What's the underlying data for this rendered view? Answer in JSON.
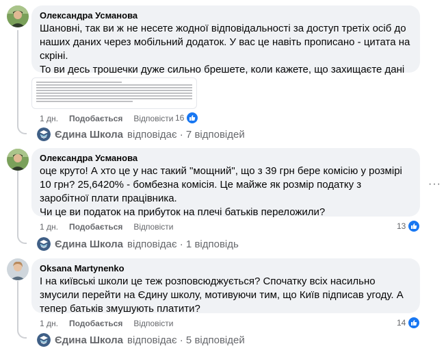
{
  "comments": [
    {
      "author": "Олександра Усманова",
      "paragraphs": [
        "Шановні, так ви ж не несете жодної відповідальності за доступ третіх осіб до наших даних через мобільний додаток. У вас це навіть прописано - цитата на скріні.",
        "То ви десь трошечки дуже сильно брешете, коли кажете, що захищаєте дані користувачів."
      ],
      "time": "1 дн.",
      "like_label": "Подобається",
      "reply_label": "Відповісти",
      "reactions": "16",
      "replies_page": "Єдина Школа",
      "replies_text": "відповідає · 7 відповідей"
    },
    {
      "author": "Олександра Усманова",
      "paragraphs": [
        "оце круто! А хто це у нас такий \"мощний\", що з 39 грн бере комісію у розмірі 10 грн? 25,6420% - бомбезна комісія. Це майже як розмір податку з заробітної плати працівника.",
        "Чи це ви податок на прибуток на плечі батьків переложили?"
      ],
      "time": "1 дн.",
      "like_label": "Подобається",
      "reply_label": "Відповісти",
      "reactions": "13",
      "replies_page": "Єдина Школа",
      "replies_text": "відповідає · 1 відповідь"
    },
    {
      "author": "Oksana Martynenko",
      "paragraphs": [
        "І на київські школи це теж розповсюджується? Спочатку всіх насильно змусили перейти на Єдину школу, мотивуючи тим, що Київ підписав угоду. А тепер батьків змушують платити?"
      ],
      "time": "1 дн.",
      "like_label": "Подобається",
      "reply_label": "Відповісти",
      "reactions": "14",
      "replies_page": "Єдина Школа",
      "replies_text": "відповідає · 5 відповідей"
    }
  ],
  "more_options": "···",
  "colors": {
    "like_blue": "#1877f2",
    "bubble": "#f0f2f5",
    "secondary_text": "#65676b",
    "thread_line": "#ced0d4"
  }
}
